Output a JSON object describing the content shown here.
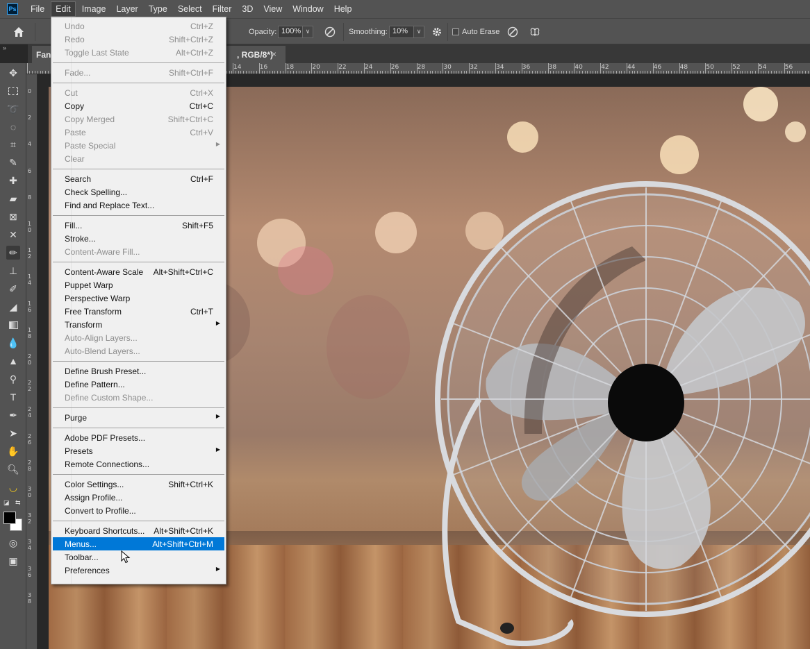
{
  "app": {
    "logo": "Ps",
    "menus": [
      "File",
      "Edit",
      "Image",
      "Layer",
      "Type",
      "Select",
      "Filter",
      "3D",
      "View",
      "Window",
      "Help"
    ],
    "active_menu": "Edit"
  },
  "options_bar": {
    "opacity_label": "Opacity:",
    "opacity_value": "100%",
    "smoothing_label": "Smoothing:",
    "smoothing_value": "10%",
    "auto_erase_label": "Auto Erase"
  },
  "document_tab": {
    "name_visible": "Fan.",
    "title_suffix": ", RGB/8*)",
    "close": "×"
  },
  "ruler": {
    "h_labels": [
      "14",
      "16",
      "18",
      "20",
      "22",
      "24",
      "26",
      "28",
      "30",
      "32",
      "34",
      "36",
      "38",
      "40",
      "42",
      "44",
      "46",
      "48",
      "50",
      "52",
      "54",
      "56"
    ],
    "v_labels": [
      "0",
      "2",
      "4",
      "6",
      "8",
      "1 0",
      "1 2",
      "1 4",
      "1 6",
      "1 8",
      "2 0",
      "2 2",
      "2 4",
      "2 6",
      "2 8",
      "3 0",
      "3 2",
      "3 4",
      "3 6",
      "3 8"
    ]
  },
  "edit_menu": {
    "groups": [
      [
        {
          "label": "Undo",
          "shortcut": "Ctrl+Z",
          "disabled": true
        },
        {
          "label": "Redo",
          "shortcut": "Shift+Ctrl+Z",
          "disabled": true
        },
        {
          "label": "Toggle Last State",
          "shortcut": "Alt+Ctrl+Z",
          "disabled": true
        }
      ],
      [
        {
          "label": "Fade...",
          "shortcut": "Shift+Ctrl+F",
          "disabled": true
        }
      ],
      [
        {
          "label": "Cut",
          "shortcut": "Ctrl+X",
          "disabled": true
        },
        {
          "label": "Copy",
          "shortcut": "Ctrl+C",
          "disabled": false
        },
        {
          "label": "Copy Merged",
          "shortcut": "Shift+Ctrl+C",
          "disabled": true
        },
        {
          "label": "Paste",
          "shortcut": "Ctrl+V",
          "disabled": true
        },
        {
          "label": "Paste Special",
          "shortcut": "",
          "disabled": true,
          "submenu": true
        },
        {
          "label": "Clear",
          "shortcut": "",
          "disabled": true
        }
      ],
      [
        {
          "label": "Search",
          "shortcut": "Ctrl+F",
          "disabled": false
        },
        {
          "label": "Check Spelling...",
          "shortcut": "",
          "disabled": false
        },
        {
          "label": "Find and Replace Text...",
          "shortcut": "",
          "disabled": false
        }
      ],
      [
        {
          "label": "Fill...",
          "shortcut": "Shift+F5",
          "disabled": false
        },
        {
          "label": "Stroke...",
          "shortcut": "",
          "disabled": false
        },
        {
          "label": "Content-Aware Fill...",
          "shortcut": "",
          "disabled": true
        }
      ],
      [
        {
          "label": "Content-Aware Scale",
          "shortcut": "Alt+Shift+Ctrl+C",
          "disabled": false
        },
        {
          "label": "Puppet Warp",
          "shortcut": "",
          "disabled": false
        },
        {
          "label": "Perspective Warp",
          "shortcut": "",
          "disabled": false
        },
        {
          "label": "Free Transform",
          "shortcut": "Ctrl+T",
          "disabled": false
        },
        {
          "label": "Transform",
          "shortcut": "",
          "disabled": false,
          "submenu": true
        },
        {
          "label": "Auto-Align Layers...",
          "shortcut": "",
          "disabled": true
        },
        {
          "label": "Auto-Blend Layers...",
          "shortcut": "",
          "disabled": true
        }
      ],
      [
        {
          "label": "Define Brush Preset...",
          "shortcut": "",
          "disabled": false
        },
        {
          "label": "Define Pattern...",
          "shortcut": "",
          "disabled": false
        },
        {
          "label": "Define Custom Shape...",
          "shortcut": "",
          "disabled": true
        }
      ],
      [
        {
          "label": "Purge",
          "shortcut": "",
          "disabled": false,
          "submenu": true
        }
      ],
      [
        {
          "label": "Adobe PDF Presets...",
          "shortcut": "",
          "disabled": false
        },
        {
          "label": "Presets",
          "shortcut": "",
          "disabled": false,
          "submenu": true
        },
        {
          "label": "Remote Connections...",
          "shortcut": "",
          "disabled": false
        }
      ],
      [
        {
          "label": "Color Settings...",
          "shortcut": "Shift+Ctrl+K",
          "disabled": false
        },
        {
          "label": "Assign Profile...",
          "shortcut": "",
          "disabled": false
        },
        {
          "label": "Convert to Profile...",
          "shortcut": "",
          "disabled": false
        }
      ],
      [
        {
          "label": "Keyboard Shortcuts...",
          "shortcut": "Alt+Shift+Ctrl+K",
          "disabled": false
        },
        {
          "label": "Menus...",
          "shortcut": "Alt+Shift+Ctrl+M",
          "disabled": false,
          "highlighted": true
        },
        {
          "label": "Toolbar...",
          "shortcut": "",
          "disabled": false
        },
        {
          "label": "Preferences",
          "shortcut": "",
          "disabled": false,
          "submenu": true
        }
      ]
    ]
  },
  "toolbar_tools": [
    "move-tool",
    "marquee-tool",
    "lasso-tool",
    "quick-select-tool",
    "crop-tool",
    "eyedropper-tool",
    "healing-brush-tool",
    "brush-tool",
    "frame-tool",
    "content-aware-move-tool",
    "pencil-tool",
    "clone-stamp-tool",
    "history-brush-tool",
    "eraser-tool",
    "gradient-tool",
    "blur-tool",
    "sharpen-tool",
    "dodge-tool",
    "type-tool",
    "pen-tool",
    "path-selection-tool",
    "hand-tool",
    "zoom-tool",
    "banana-tool"
  ],
  "colors": {
    "ui_dark": "#535353",
    "menu_bg": "#f0f0f0",
    "highlight": "#0078d7",
    "foreground": "#000000",
    "background": "#ffffff"
  }
}
